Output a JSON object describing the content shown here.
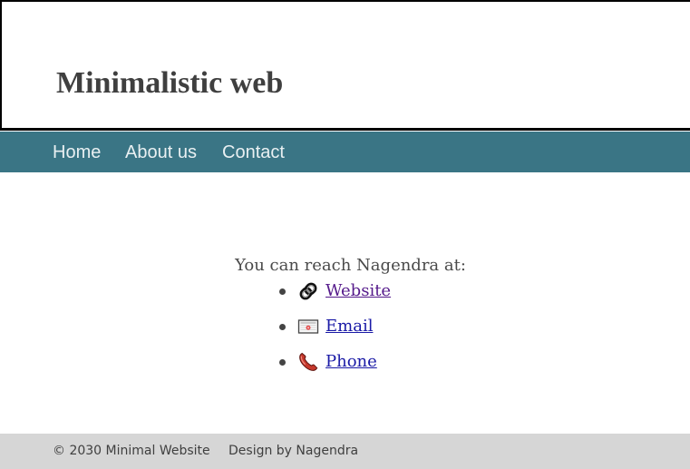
{
  "header": {
    "title": "Minimalistic web"
  },
  "nav": {
    "items": [
      {
        "label": "Home"
      },
      {
        "label": "About us"
      },
      {
        "label": "Contact"
      }
    ]
  },
  "main": {
    "intro": "You can reach Nagendra at:",
    "contacts": [
      {
        "label": "Website",
        "icon": "link-icon",
        "visited": true
      },
      {
        "label": "Email",
        "icon": "envelope-icon",
        "visited": false
      },
      {
        "label": "Phone",
        "icon": "telephone-icon",
        "visited": false
      }
    ]
  },
  "footer": {
    "copyright": "© 2030 Minimal Website",
    "credit": "Design by Nagendra"
  },
  "colors": {
    "nav_background": "#3a7585",
    "nav_text": "#e9f0f2",
    "footer_background": "#d6d6d6",
    "link": "#1a1aa6",
    "visited_link": "#551a8b",
    "title_text": "#3f3f3f"
  }
}
